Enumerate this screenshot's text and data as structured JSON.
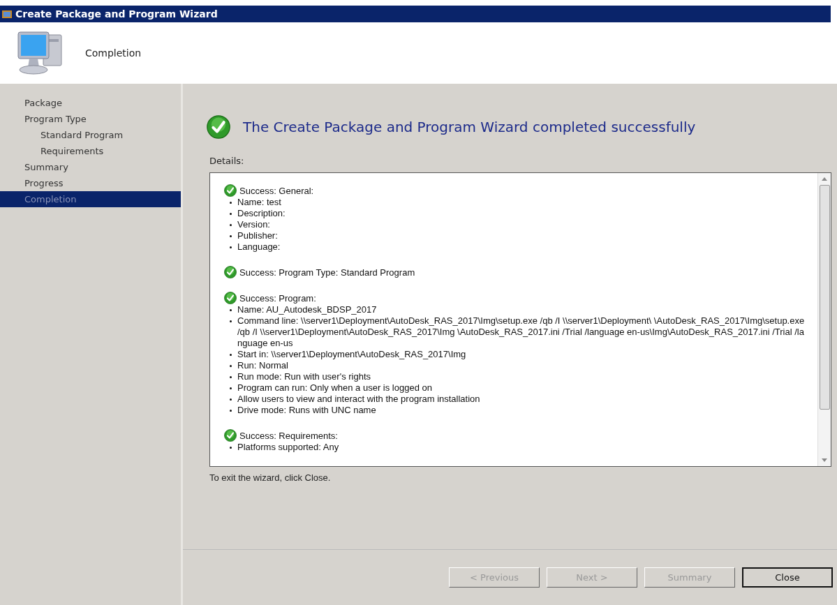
{
  "window": {
    "title": "Create Package and Program Wizard"
  },
  "header": {
    "title": "Completion"
  },
  "sidebar": {
    "items": [
      {
        "label": "Package",
        "selected": false
      },
      {
        "label": "Program Type",
        "selected": false,
        "children": [
          {
            "label": "Standard Program",
            "selected": false
          },
          {
            "label": "Requirements",
            "selected": false
          }
        ]
      },
      {
        "label": "Summary",
        "selected": false
      },
      {
        "label": "Progress",
        "selected": false
      },
      {
        "label": "Completion",
        "selected": true
      }
    ]
  },
  "main": {
    "heading": "The Create Package and Program Wizard completed successfully",
    "details_label": "Details:",
    "details": [
      {
        "title": "Success: General:",
        "items": [
          "Name: test",
          "Description:",
          "Version:",
          "Publisher:",
          "Language:"
        ]
      },
      {
        "title": "Success: Program Type: Standard Program"
      },
      {
        "title": "Success: Program:",
        "items": [
          "Name: AU_Autodesk_BDSP_2017",
          "Command line: \\\\server1\\Deployment\\AutoDesk_RAS_2017\\Img\\setup.exe /qb /I \\\\server1\\Deployment\\ \\AutoDesk_RAS_2017\\Img\\setup.exe /qb /I \\\\server1\\Deployment\\AutoDesk_RAS_2017\\Img \\AutoDesk_RAS_2017.ini /Trial /language en-us\\Img\\AutoDesk_RAS_2017.ini /Trial /language en-us",
          "Start in: \\\\server1\\Deployment\\AutoDesk_RAS_2017\\Img",
          "Run: Normal",
          "Run mode: Run with user's rights",
          "Program can run: Only when a user is logged on",
          "Allow users to view and interact with the program installation",
          "Drive mode: Runs with UNC name"
        ]
      },
      {
        "title": "Success: Requirements:",
        "items": [
          "Platforms supported: Any"
        ]
      }
    ],
    "footer_note": "To exit the wizard, click Close."
  },
  "buttons": [
    {
      "label": "< Previous",
      "disabled": true,
      "default": false
    },
    {
      "label": "Next >",
      "disabled": true,
      "default": false
    },
    {
      "label": "Summary",
      "disabled": true,
      "default": false
    },
    {
      "label": "Close",
      "disabled": false,
      "default": true
    }
  ]
}
